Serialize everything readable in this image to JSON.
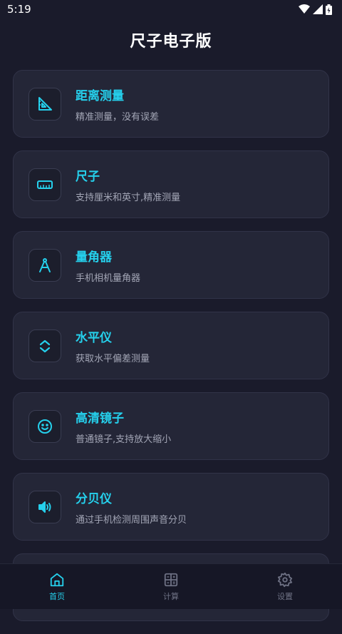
{
  "status": {
    "time": "5:19"
  },
  "title": "尺子电子版",
  "cards": [
    {
      "title": "距离测量",
      "subtitle": "精准测量，没有误差",
      "icon": "set-square-icon"
    },
    {
      "title": "尺子",
      "subtitle": "支持厘米和英寸,精准测量",
      "icon": "ruler-icon"
    },
    {
      "title": "量角器",
      "subtitle": "手机相机量角器",
      "icon": "compass-icon"
    },
    {
      "title": "水平仪",
      "subtitle": "获取水平偏差测量",
      "icon": "level-icon"
    },
    {
      "title": "高清镜子",
      "subtitle": "普通镜子,支持放大缩小",
      "icon": "smile-icon"
    },
    {
      "title": "分贝仪",
      "subtitle": "通过手机检测周围声音分贝",
      "icon": "speaker-icon"
    }
  ],
  "tabs": [
    {
      "label": "首页",
      "icon": "home-icon",
      "active": true
    },
    {
      "label": "计算",
      "icon": "calculator-icon",
      "active": false
    },
    {
      "label": "设置",
      "icon": "gear-icon",
      "active": false
    }
  ],
  "colors": {
    "accent": "#25d0ec",
    "background": "#1a1b2b",
    "card": "#242637"
  }
}
